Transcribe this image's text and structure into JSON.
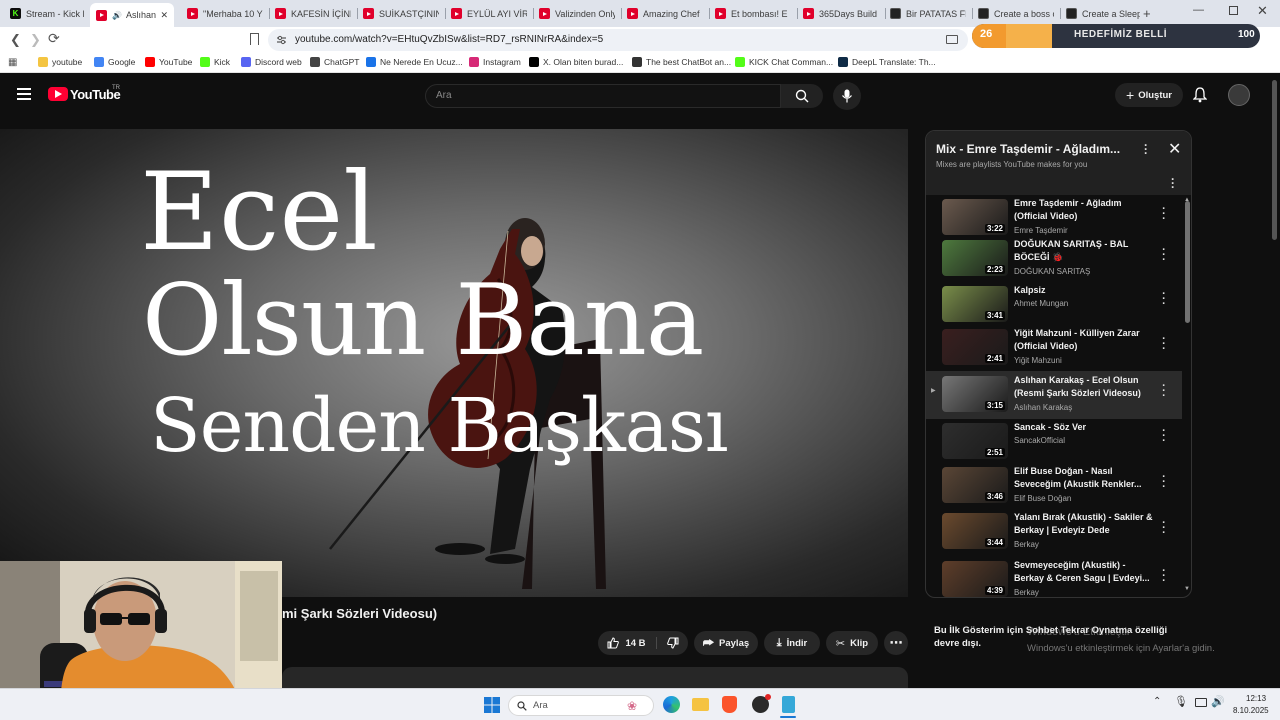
{
  "browser": {
    "tabs": [
      {
        "label": "Stream - Kick E",
        "icon": "kick"
      },
      {
        "label": "Aslıhan",
        "icon": "youtube",
        "active": true
      },
      {
        "label": "\"Merhaba 10 Y",
        "icon": "youtube"
      },
      {
        "label": "KAFESİN İÇİNDE",
        "icon": "youtube"
      },
      {
        "label": "SUİKASTÇININ",
        "icon": "youtube"
      },
      {
        "label": "EYLÜL AYI VİRA",
        "icon": "youtube"
      },
      {
        "label": "Valizinden Only",
        "icon": "youtube"
      },
      {
        "label": "Amazing Chef",
        "icon": "youtube"
      },
      {
        "label": "Et bombası! E",
        "icon": "youtube"
      },
      {
        "label": "365Days Build",
        "icon": "youtube"
      },
      {
        "label": "Bir PATATAS FR",
        "icon": "doc"
      },
      {
        "label": "Create a boss c",
        "icon": "doc"
      },
      {
        "label": "Create a Sleep",
        "icon": "doc"
      }
    ],
    "new_tab": "+",
    "url": "youtube.com/watch?v=EHtuQvZbISw&list=RD7_rsRNINrRA&index=5",
    "bookmarks": [
      {
        "label": "youtube",
        "color": "#f4c542"
      },
      {
        "label": "Google",
        "color": "#4285f4"
      },
      {
        "label": "YouTube",
        "color": "#ff0000"
      },
      {
        "label": "Kick",
        "color": "#53fc18"
      },
      {
        "label": "Discord web",
        "color": "#5865f2"
      },
      {
        "label": "ChatGPT",
        "color": "#444444"
      },
      {
        "label": "Ne Nerede En Ucuz...",
        "color": "#1a73e8"
      },
      {
        "label": "Instagram",
        "color": "#d62976"
      },
      {
        "label": "X. Olan biten burad...",
        "color": "#000000"
      },
      {
        "label": "The best ChatBot an...",
        "color": "#333333"
      },
      {
        "label": "KICK Chat Comman...",
        "color": "#53fc18"
      },
      {
        "label": "DeepL Translate: Th...",
        "color": "#0f2b46"
      }
    ]
  },
  "streak": {
    "current": "26",
    "label": "HEDEFİMİZ BELLİ",
    "target": "100"
  },
  "youtube": {
    "logo_text": "YouTube",
    "country": "TR",
    "search_placeholder": "Ara",
    "create_label": "Oluştur"
  },
  "video": {
    "lyric_line1": "Ecel",
    "lyric_line2": "Olsun Bana",
    "lyric_line3": "Senden Başkası",
    "title_visible": "mi Şarkı Sözleri Videosu)",
    "like_count": "14 B",
    "share_label": "Paylaş",
    "download_label": "İndir",
    "clip_label": "Klip"
  },
  "playlist": {
    "title": "Mix - Emre Taşdemir - Ağladım...",
    "subtitle": "Mixes are playlists YouTube makes for you",
    "items": [
      {
        "title": "Emre Taşdemir - Ağladım (Official Video)",
        "channel": "Emre Taşdemir",
        "duration": "3:22",
        "thumb": "#6b5a4e"
      },
      {
        "title": "DOĞUKAN SARITAŞ - BAL BÖCEĞİ 🐞",
        "channel": "DOĞUKAN SARITAŞ",
        "duration": "2:23",
        "thumb": "#4e7a3e"
      },
      {
        "title": "Kalpsiz",
        "channel": "Ahmet Mungan",
        "duration": "3:41",
        "thumb": "#7a8e4a"
      },
      {
        "title": "Yiğit Mahzuni - Külliyen Zarar (Official Video)",
        "channel": "Yiğit Mahzuni",
        "duration": "2:41",
        "thumb": "#3a1f1f"
      },
      {
        "title": "Aslıhan Karakaş - Ecel Olsun (Resmi Şarkı Sözleri Videosu)",
        "channel": "Aslıhan Karakaş",
        "duration": "3:15",
        "thumb": "#777777",
        "current": true
      },
      {
        "title": "Sancak - Söz Ver",
        "channel": "SancakOfficial",
        "duration": "2:51",
        "thumb": "#2e2e2e"
      },
      {
        "title": "Elif Buse Doğan - Nasıl Seveceğim (Akustik Renkler...",
        "channel": "Elif Buse Doğan",
        "duration": "3:46",
        "thumb": "#5a4636"
      },
      {
        "title": "Yalanı Bırak (Akustik) - Sakiler & Berkay | Evdeyiz Dede",
        "channel": "Berkay",
        "duration": "3:44",
        "thumb": "#6b4a2e"
      },
      {
        "title": "Sevmeyeceğim (Akustik) - Berkay & Ceren Sagu | Evdeyi...",
        "channel": "Berkay",
        "duration": "4:39",
        "thumb": "#5e3e2a"
      }
    ]
  },
  "below_playlist_text": "Bu İlk Gösterim için Sohbet Tekrar Oynatma özelliği devre dışı.",
  "watermark": {
    "line1": "Windows'u Etkinleştir",
    "line2": "Windows'u etkinleştirmek için Ayarlar'a gidin."
  },
  "taskbar": {
    "search_placeholder": "Ara",
    "time": "12:13",
    "date": "8.10.2025"
  }
}
